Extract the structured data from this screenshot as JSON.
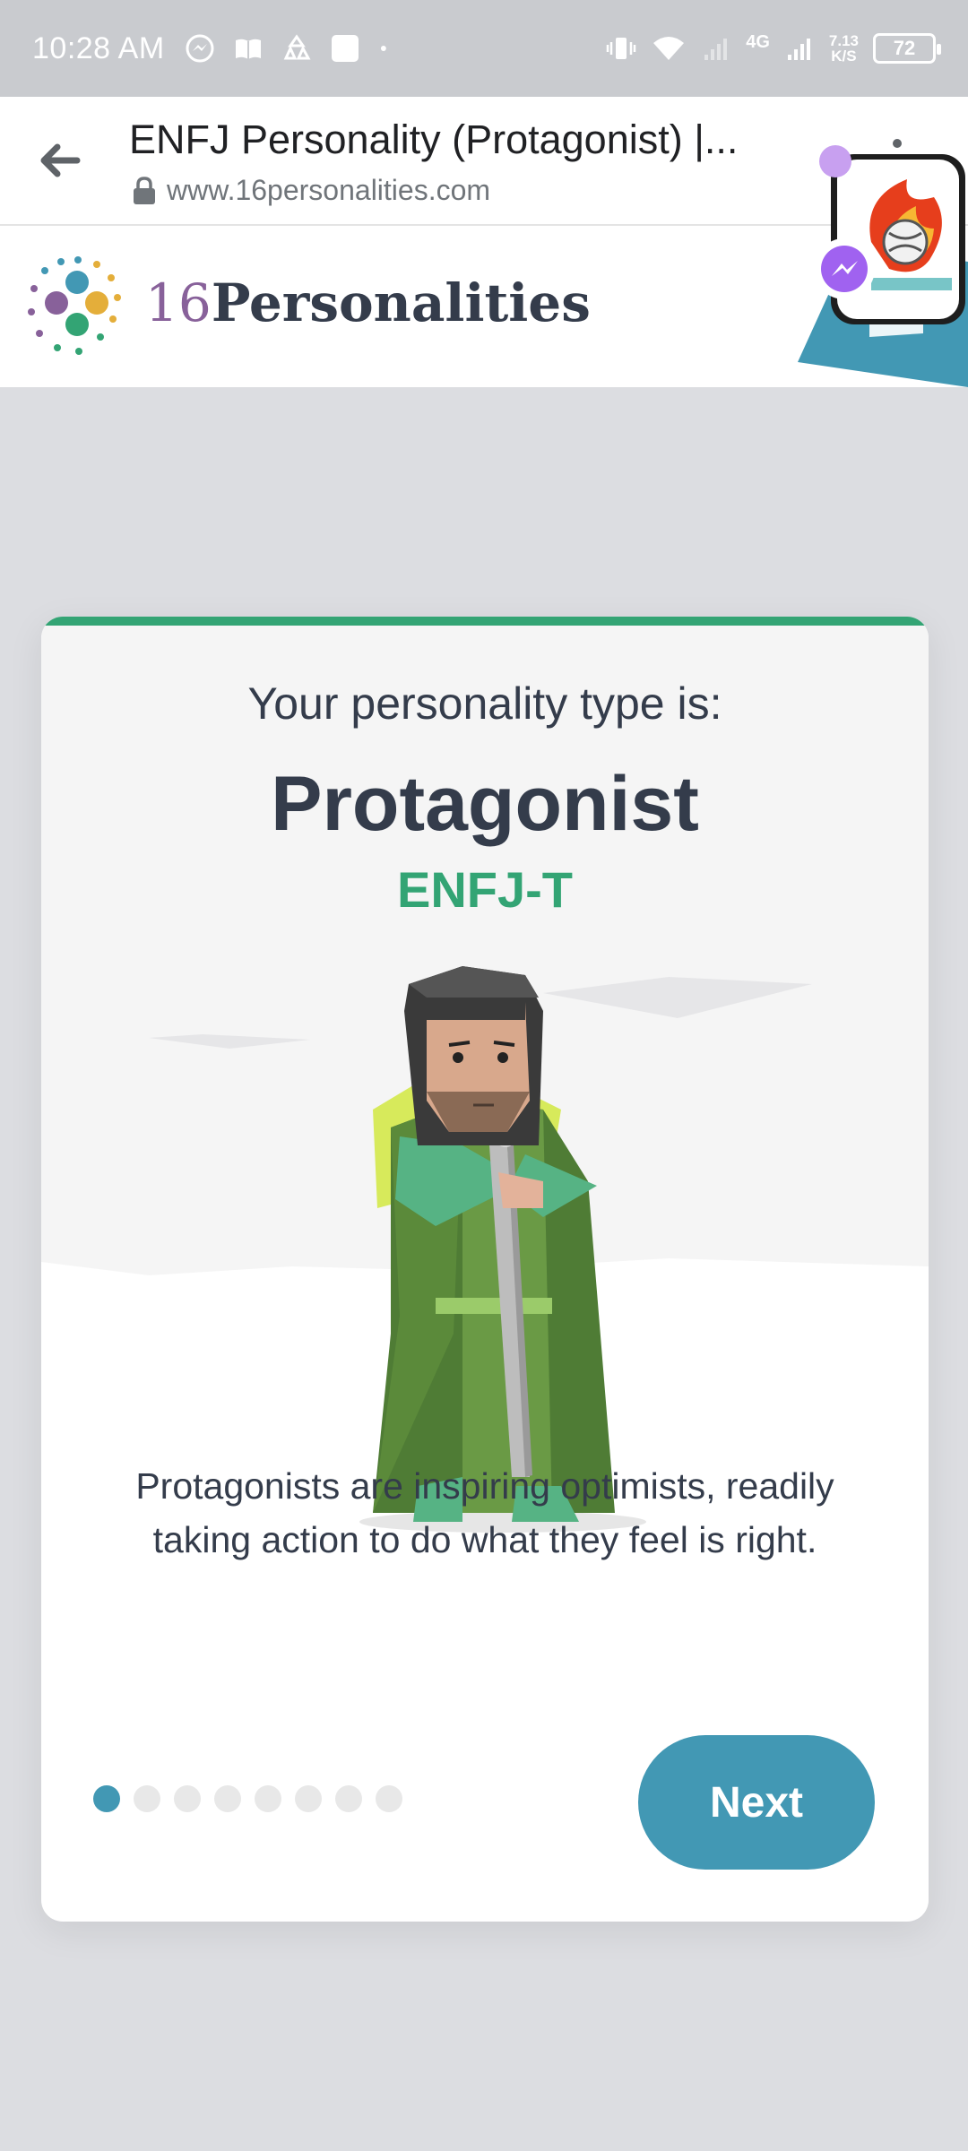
{
  "status_bar": {
    "time": "10:28 AM",
    "net_speed_value": "7.13",
    "net_speed_unit": "K/S",
    "network": "4G",
    "battery": "72",
    "icons": [
      "messenger-icon",
      "book-icon",
      "sync-icon",
      "square-icon",
      "dot-icon",
      "vibrate-icon",
      "wifi-icon",
      "signal-icon"
    ]
  },
  "browser": {
    "title": "ENFJ Personality (Protagonist) |...",
    "url": "www.16personalities.com"
  },
  "site": {
    "logo_number": "16",
    "logo_word": "Personalities"
  },
  "card": {
    "intro": "Your personality type is:",
    "type_name": "Protagonist",
    "type_code": "ENFJ-T",
    "description_line1": "Protagonists are inspiring optimists, readily",
    "description_line2": "taking action to do what they feel is right.",
    "next_label": "Next",
    "pagination": {
      "total": 8,
      "current": 1
    }
  },
  "colors": {
    "accent_green": "#33a474",
    "accent_blue": "#4298b4",
    "text_dark": "#343c4b",
    "logo_purple": "#88619a"
  }
}
